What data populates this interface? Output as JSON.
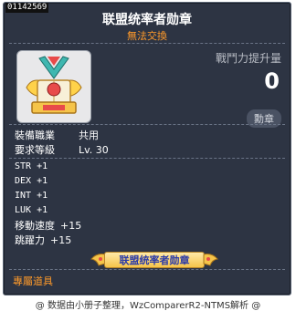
{
  "item": {
    "id": "01142569",
    "name": "联盟统率者勋章",
    "trade_status": "無法交換"
  },
  "combat": {
    "label": "戰鬥力提升量",
    "value": "0",
    "category_tag": "勳章"
  },
  "requirements": [
    {
      "key": "裝備職業",
      "value": "共用"
    },
    {
      "key": "要求等級",
      "value": "Lv. 30"
    }
  ],
  "stats": [
    {
      "key": "STR",
      "value": "+1"
    },
    {
      "key": "DEX",
      "value": "+1"
    },
    {
      "key": "INT",
      "value": "+1"
    },
    {
      "key": "LUK",
      "value": "+1"
    },
    {
      "key": "移動速度",
      "value": "+15"
    },
    {
      "key": "跳躍力",
      "value": "+15"
    }
  ],
  "medal_banner": "联盟统率者勋章",
  "exclusive_label": "專屬道具",
  "footer": "@ 数据由小册子整理，WzComparerR2-NTMS解析 @",
  "colors": {
    "background": "#2d3443",
    "accent_orange": "#ff9a2a",
    "banner_text": "#2a3aa8"
  },
  "icons": [
    "medal-icon"
  ]
}
